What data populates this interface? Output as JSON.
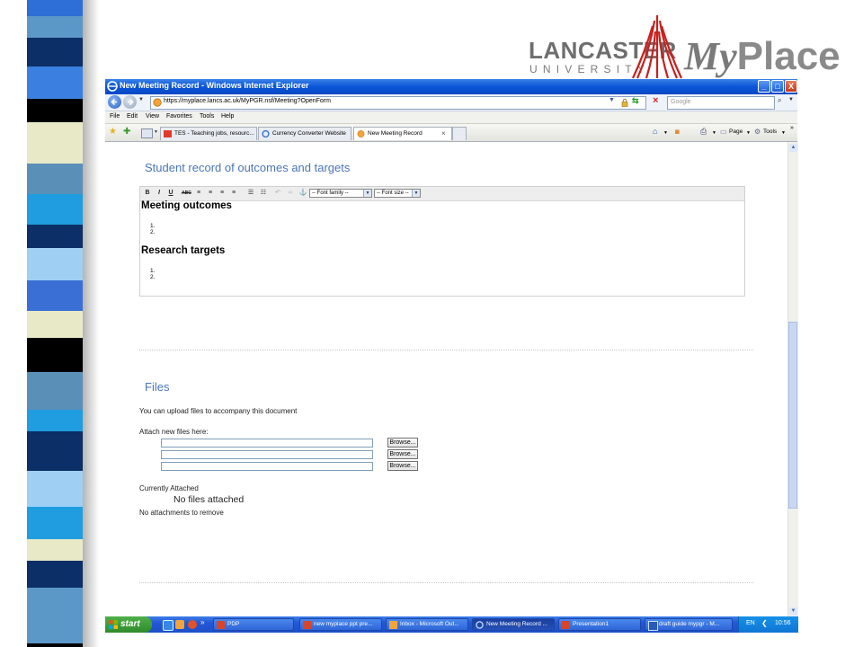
{
  "logo": {
    "lancaster": "LANCASTER",
    "university": "UNIVERSITY",
    "my": "My",
    "place": "Place"
  },
  "browser": {
    "title": "New Meeting Record - Windows Internet Explorer",
    "url": "https://myplace.lancs.ac.uk/MyPGR.nsf/Meeting?OpenForm",
    "search_placeholder": "Google",
    "menu": [
      "File",
      "Edit",
      "View",
      "Favorites",
      "Tools",
      "Help"
    ],
    "tabs": [
      {
        "label": "TES - Teaching jobs, resourc..."
      },
      {
        "label": "Currency Converter Website"
      },
      {
        "label": "New Meeting Record"
      }
    ],
    "commands": {
      "page": "Page",
      "tools": "Tools"
    },
    "window_buttons": {
      "minimize": "_",
      "maximize": "□",
      "close": "X"
    }
  },
  "page": {
    "outcomes_section": {
      "title": "Student record of outcomes and targets",
      "editor": {
        "font_family_placeholder": "-- Font family --",
        "font_size_placeholder": "-- Font size --",
        "meeting_outcomes_heading": "Meeting outcomes",
        "meeting_outcomes_items": [
          "1.",
          "2."
        ],
        "research_targets_heading": "Research targets",
        "research_targets_items": [
          "1.",
          "2."
        ]
      }
    },
    "files_section": {
      "title": "Files",
      "intro": "You can upload files to accompany this document",
      "attach_label": "Attach new files here:",
      "browse_label": "Browse...",
      "currently_attached_label": "Currently Attached",
      "no_files": "No files attached",
      "no_attachments": "No attachments to remove"
    }
  },
  "taskbar": {
    "start": "start",
    "items": [
      {
        "label": "PDP"
      },
      {
        "label": "new myplace ppt pre..."
      },
      {
        "label": "Inbox - Microsoft Out..."
      },
      {
        "label": "New Meeting Record ..."
      },
      {
        "label": "Presentation1"
      },
      {
        "label": "draft guide mypgr - M..."
      }
    ],
    "language": "EN",
    "clock": "10:56"
  },
  "colors": {
    "section_title": "#4a76b8",
    "xp_blue": "#2457d6",
    "start_green": "#3a9a35"
  }
}
